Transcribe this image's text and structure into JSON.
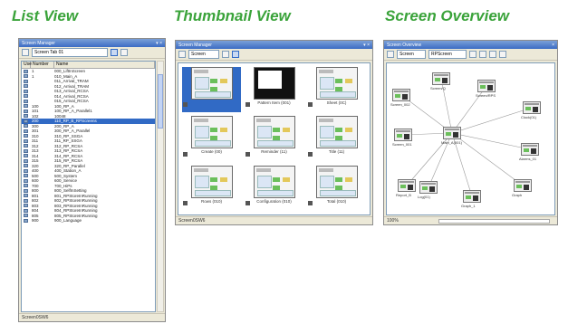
{
  "headings": {
    "list_view": "List View",
    "thumbnail_view": "Thumbnail View",
    "screen_overview": "Screen Overview"
  },
  "list_panel": {
    "title": "Screen Manager",
    "combo": "Screen Tab 01",
    "columns": [
      "Use",
      "Number",
      "Name"
    ],
    "rows": [
      {
        "no": "1",
        "name": "000_LiftInScreen"
      },
      {
        "no": "1",
        "name": "010_Main_A"
      },
      {
        "no": "",
        "name": "011_Arrival_TRAM"
      },
      {
        "no": "",
        "name": "012_Arrival_TRAM"
      },
      {
        "no": "",
        "name": "013_Arrival_RCSA"
      },
      {
        "no": "",
        "name": "014_Arrival_RCSA"
      },
      {
        "no": "",
        "name": "015_Arrival_RCSA"
      },
      {
        "no": "100",
        "name": "100_RP_A"
      },
      {
        "no": "101",
        "name": "100_RP_A_Parallel1"
      },
      {
        "no": "102",
        "name": "10048"
      },
      {
        "no": "200",
        "name": "110_RP_B_RPScreens"
      },
      {
        "no": "300",
        "name": "200_RP_A"
      },
      {
        "no": "301",
        "name": "300_RP_A_Parallel"
      },
      {
        "no": "310",
        "name": "310_RP_SSGA"
      },
      {
        "no": "311",
        "name": "311_RP_SSGA"
      },
      {
        "no": "312",
        "name": "312_RP_RCSA"
      },
      {
        "no": "313",
        "name": "313_RP_RCSA"
      },
      {
        "no": "314",
        "name": "314_RP_RCSA"
      },
      {
        "no": "315",
        "name": "315_RP_RCSA"
      },
      {
        "no": "320",
        "name": "320_RP_Parallel"
      },
      {
        "no": "400",
        "name": "400_Station_A"
      },
      {
        "no": "500",
        "name": "500_System"
      },
      {
        "no": "600",
        "name": "600_Service"
      },
      {
        "no": "700",
        "name": "700_HiPs"
      },
      {
        "no": "800",
        "name": "800_SelfInSetting"
      },
      {
        "no": "801",
        "name": "801_RPStoreInRunning"
      },
      {
        "no": "802",
        "name": "802_RPStoreInRunning"
      },
      {
        "no": "803",
        "name": "803_RPStoreInRunning"
      },
      {
        "no": "804",
        "name": "804_RPStoreInRunning"
      },
      {
        "no": "805",
        "name": "805_RPStoreInRunning"
      },
      {
        "no": "900",
        "name": "900_Language"
      }
    ],
    "selected_row_index": 10,
    "status": "Screen0SW6"
  },
  "thumb_panel": {
    "title": "Screen Manager",
    "combo": "Screen",
    "items": [
      {
        "label": "",
        "style": "selected"
      },
      {
        "label": "Pattern Item (001)",
        "style": "dark"
      },
      {
        "label": "Sheet (0C)",
        "style": "normal"
      },
      {
        "label": "Create (00)",
        "style": "normal"
      },
      {
        "label": "Reminder (11)",
        "style": "normal"
      },
      {
        "label": "Title (11)",
        "style": "normal"
      },
      {
        "label": "Rows (010)",
        "style": "normal"
      },
      {
        "label": "Configuration (010)",
        "style": "normal"
      },
      {
        "label": "Total (010)",
        "style": "normal"
      }
    ],
    "status": "Screen0SW6"
  },
  "overview_panel": {
    "title": "Screen Overview",
    "combo": "Screen",
    "combo2": "RPScreen",
    "nodes": [
      {
        "label": "Screen_002"
      },
      {
        "label": "Screen/Q"
      },
      {
        "label": "Screen/RPS"
      },
      {
        "label": "Main_A(001)"
      },
      {
        "label": "Screen_001"
      },
      {
        "label": "Clock(01)"
      },
      {
        "label": "Alarms_01"
      },
      {
        "label": "Report_B"
      },
      {
        "label": "Log(01)"
      },
      {
        "label": "Graph_1"
      },
      {
        "label": "Graph"
      }
    ],
    "status": "100%"
  }
}
